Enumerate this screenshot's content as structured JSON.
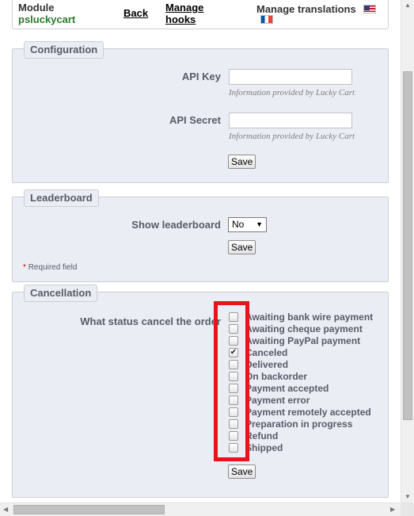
{
  "toolbar": {
    "module_label": "Module",
    "module_name": "psluckycart",
    "back": "Back",
    "manage_hooks_line1": "Manage",
    "manage_hooks_line2": "hooks",
    "manage_translations": "Manage translations"
  },
  "configuration": {
    "legend": "Configuration",
    "api_key_label": "API Key",
    "api_key_value": "",
    "api_key_hint": "Information provided by Lucky Cart",
    "api_secret_label": "API Secret",
    "api_secret_value": "",
    "api_secret_hint": "Information provided by Lucky Cart",
    "save": "Save"
  },
  "leaderboard": {
    "legend": "Leaderboard",
    "show_label": "Show leaderboard",
    "show_value": "No",
    "save": "Save",
    "required_note": "Required field"
  },
  "cancellation": {
    "legend": "Cancellation",
    "question": "What status cancel the order",
    "statuses": [
      {
        "label": "Awaiting bank wire payment",
        "checked": false
      },
      {
        "label": "Awaiting cheque payment",
        "checked": false
      },
      {
        "label": "Awaiting PayPal payment",
        "checked": false
      },
      {
        "label": "Canceled",
        "checked": true
      },
      {
        "label": "Delivered",
        "checked": false
      },
      {
        "label": "On backorder",
        "checked": false
      },
      {
        "label": "Payment accepted",
        "checked": false
      },
      {
        "label": "Payment error",
        "checked": false
      },
      {
        "label": "Payment remotely accepted",
        "checked": false
      },
      {
        "label": "Preparation in progress",
        "checked": false
      },
      {
        "label": "Refund",
        "checked": false
      },
      {
        "label": "Shipped",
        "checked": false
      }
    ],
    "save": "Save"
  },
  "colors": {
    "panel_bg": "#ebedf4",
    "highlight": "#e8141a"
  }
}
